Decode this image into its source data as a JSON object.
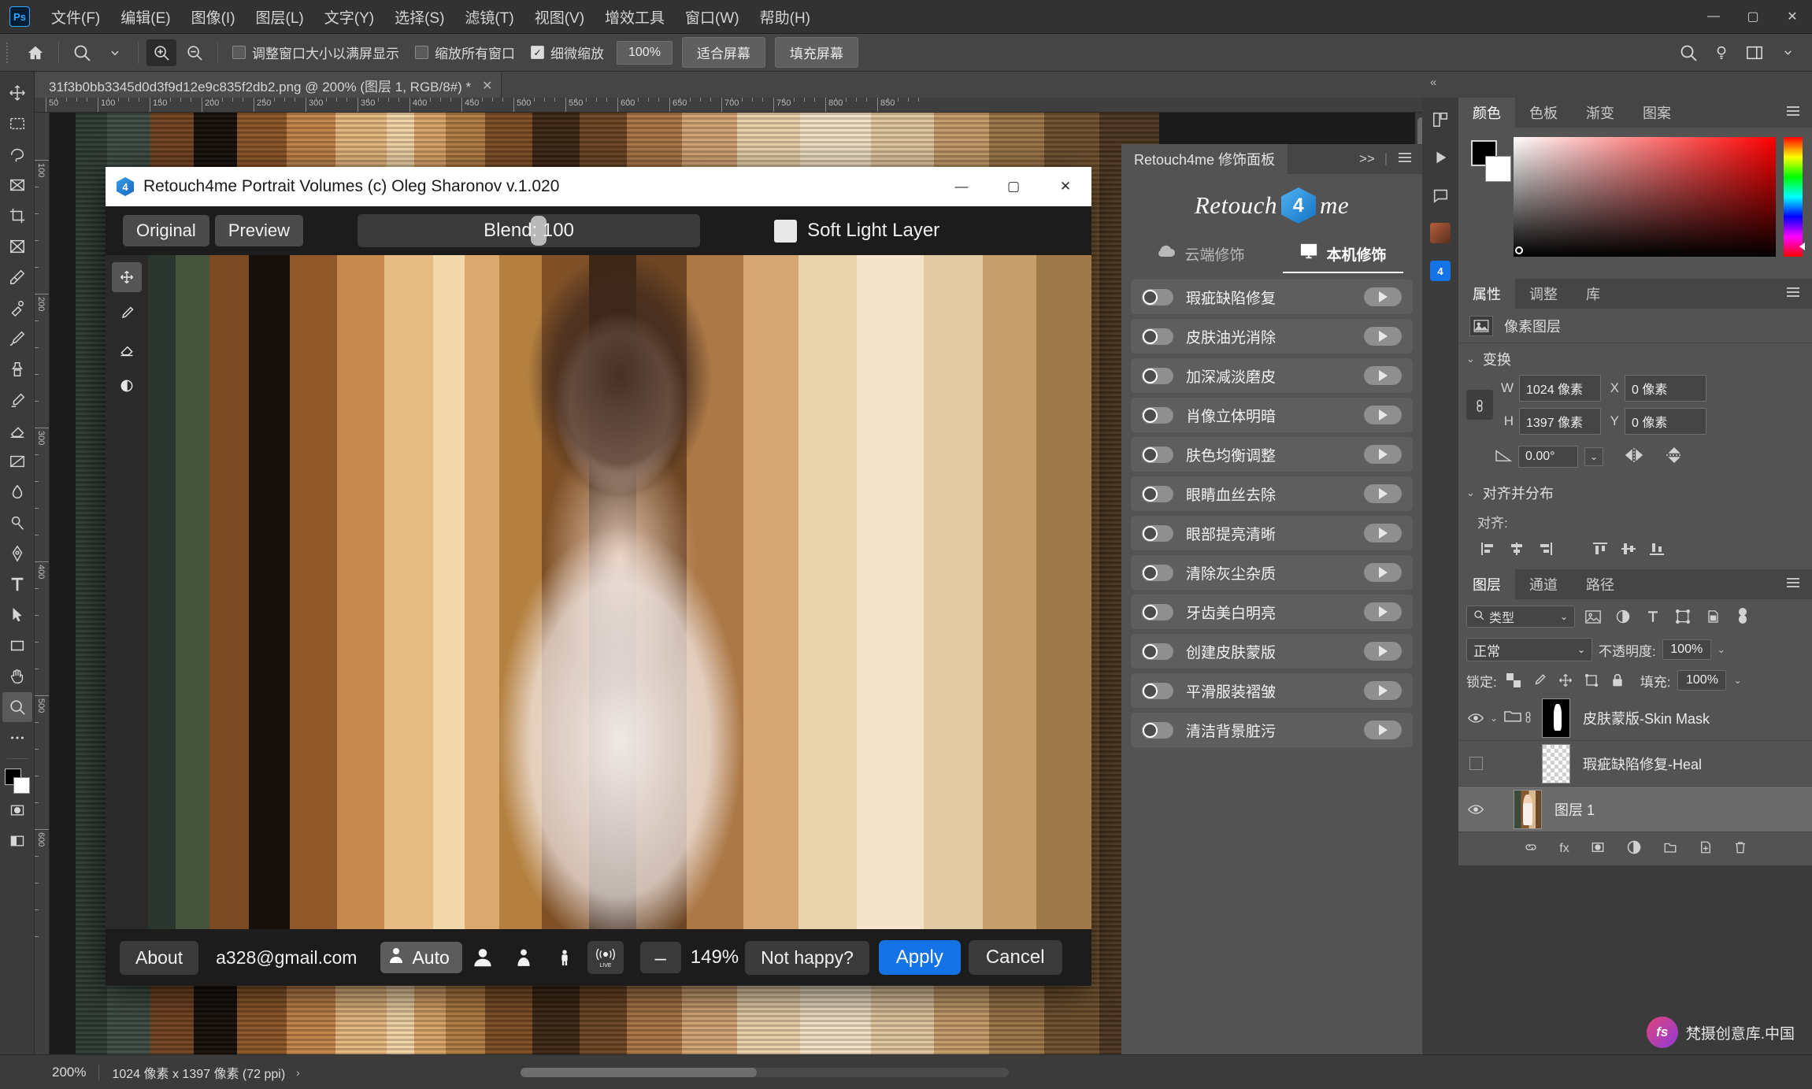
{
  "app": {
    "logo": "Ps",
    "menus": [
      "文件(F)",
      "编辑(E)",
      "图像(I)",
      "图层(L)",
      "文字(Y)",
      "选择(S)",
      "滤镜(T)",
      "视图(V)",
      "增效工具",
      "窗口(W)",
      "帮助(H)"
    ],
    "window_controls": {
      "minimize": "—",
      "maximize": "▢",
      "close": "✕"
    }
  },
  "options_bar": {
    "home_icon": "home-icon",
    "zoom_tool_icon": "zoom-tool-icon",
    "dropdown_icon": "chevron-down-icon",
    "zoom_in_icon": "zoom-in-icon",
    "zoom_out_icon": "zoom-out-icon",
    "check_resize_window": {
      "label": "调整窗口大小以满屏显示",
      "checked": false
    },
    "check_zoom_all_windows": {
      "label": "缩放所有窗口",
      "checked": false
    },
    "check_scrubby_zoom": {
      "label": "细微缩放",
      "checked": true
    },
    "zoom_value": "100%",
    "fit_screen": "适合屏幕",
    "fill_screen": "填充屏幕",
    "right_search_icon": "search-icon",
    "right_bulb_icon": "lightbulb-icon",
    "right_workspace_icon": "workspace-icon",
    "right_chevron_icon": "chevron-down-icon"
  },
  "document_tab": {
    "title": "31f3b0bb3345d0d3f9d12e9c835f2db2.png @ 200% (图层 1, RGB/8#) *",
    "close": "✕"
  },
  "toolbar": {
    "tools": [
      {
        "name": "move-tool",
        "glyph": "move"
      },
      {
        "name": "marquee-tool",
        "glyph": "marquee"
      },
      {
        "name": "lasso-tool",
        "glyph": "lasso"
      },
      {
        "name": "object-select-tool",
        "glyph": "objsel"
      },
      {
        "name": "crop-tool",
        "glyph": "crop"
      },
      {
        "name": "frame-tool",
        "glyph": "frame"
      },
      {
        "name": "eyedropper-tool",
        "glyph": "eyedrop"
      },
      {
        "name": "healing-brush-tool",
        "glyph": "heal"
      },
      {
        "name": "brush-tool",
        "glyph": "brush"
      },
      {
        "name": "clone-stamp-tool",
        "glyph": "stamp"
      },
      {
        "name": "history-brush-tool",
        "glyph": "histbrush"
      },
      {
        "name": "eraser-tool",
        "glyph": "eraser"
      },
      {
        "name": "gradient-tool",
        "glyph": "gradient"
      },
      {
        "name": "blur-tool",
        "glyph": "blur"
      },
      {
        "name": "dodge-tool",
        "glyph": "dodge"
      },
      {
        "name": "pen-tool",
        "glyph": "pen"
      },
      {
        "name": "type-tool",
        "glyph": "T"
      },
      {
        "name": "path-select-tool",
        "glyph": "pathsel"
      },
      {
        "name": "shape-tool",
        "glyph": "shape"
      },
      {
        "name": "hand-tool",
        "glyph": "hand"
      },
      {
        "name": "zoom-tool",
        "glyph": "zoom",
        "active": true
      },
      {
        "name": "more-tools",
        "glyph": "dots"
      }
    ],
    "foreground_color": "#000000",
    "background_color": "#ffffff",
    "quickmask_icon": "quick-mask-icon",
    "screenmode_icon": "screen-mode-icon"
  },
  "rulers": {
    "horizontal": [
      "50",
      "100",
      "150",
      "200",
      "250",
      "300",
      "350",
      "400",
      "450",
      "500",
      "550",
      "600",
      "650",
      "700",
      "750",
      "800",
      "850"
    ],
    "vertical": [
      "100",
      "200",
      "300",
      "400",
      "500",
      "600"
    ]
  },
  "plugin": {
    "title": "Retouch4me Portrait Volumes (c) Oleg Sharonov v.1.020",
    "icon": "retouch4me-icon",
    "window_controls": {
      "minimize": "—",
      "maximize": "▢",
      "close": "✕"
    },
    "original_button": "Original",
    "preview_button": "Preview",
    "blend_label": "Blend: 100",
    "blend_value": 100,
    "soft_light_layer": "Soft Light Layer",
    "soft_light_checked": true,
    "tools": [
      {
        "name": "pan-tool",
        "glyph": "move",
        "active": true
      },
      {
        "name": "brush-tool",
        "glyph": "brush"
      },
      {
        "name": "eraser-tool",
        "glyph": "eraser"
      },
      {
        "name": "mask-tool",
        "glyph": "mask"
      }
    ],
    "bottom": {
      "about": "About",
      "email": "a328@gmail.com",
      "auto_label": "Auto",
      "auto_icon": "person-auto-icon",
      "face_icon": "face-icon",
      "portrait_icon": "portrait-icon",
      "fullbody-icon": "full-body-icon",
      "live_icon": "live-icon",
      "zoom_out": "–",
      "zoom_value": "149%",
      "not_happy": "Not happy?",
      "apply": "Apply",
      "cancel": "Cancel",
      "apply_color": "#1473e6"
    }
  },
  "r4m_panel": {
    "tab_title": "Retouch4me 修饰面板",
    "expand_icon": ">>",
    "menu_icon": "hamburger-icon",
    "logo_text_left": "Retouch",
    "logo_hex": "4",
    "logo_text_right": "me",
    "modes": [
      {
        "label": "云端修饰",
        "icon": "cloud-icon",
        "active": false
      },
      {
        "label": "本机修饰",
        "icon": "monitor-icon",
        "active": true
      }
    ],
    "items": [
      {
        "label": "瑕疵缺陷修复",
        "enabled": false
      },
      {
        "label": "皮肤油光消除",
        "enabled": false
      },
      {
        "label": "加深减淡磨皮",
        "enabled": false
      },
      {
        "label": "肖像立体明暗",
        "enabled": false
      },
      {
        "label": "肤色均衡调整",
        "enabled": false
      },
      {
        "label": "眼睛血丝去除",
        "enabled": false
      },
      {
        "label": "眼部提亮清晰",
        "enabled": false
      },
      {
        "label": "清除灰尘杂质",
        "enabled": false
      },
      {
        "label": "牙齿美白明亮",
        "enabled": false
      },
      {
        "label": "创建皮肤蒙版",
        "enabled": false
      },
      {
        "label": "平滑服装褶皱",
        "enabled": false
      },
      {
        "label": "清洁背景脏污",
        "enabled": false
      }
    ]
  },
  "dock": {
    "collapse_icon": "«",
    "icons": [
      "panels-icon",
      "play-icon",
      "comment-icon",
      "retouch-plugin-icon",
      "blue-plugin-icon"
    ]
  },
  "color_panel": {
    "tabs": [
      "颜色",
      "色板",
      "渐变",
      "图案"
    ],
    "active_tab": "颜色",
    "menu_icon": "hamburger-icon",
    "foreground": "#000000",
    "background": "#ffffff"
  },
  "properties_panel": {
    "tabs": [
      "属性",
      "调整",
      "库"
    ],
    "active_tab": "属性",
    "menu_icon": "hamburger-icon",
    "layer_type_icon": "pixel-layer-icon",
    "layer_type": "像素图层",
    "transform_section": "变换",
    "w_key": "W",
    "w_value": "1024 像素",
    "x_key": "X",
    "x_value": "0 像素",
    "h_key": "H",
    "h_value": "1397 像素",
    "y_key": "Y",
    "y_value": "0 像素",
    "link_icon": "link-icon",
    "angle_icon": "angle-icon",
    "angle_value": "0.00°",
    "angle_dropdown": "chevron-down-icon",
    "flip_h_icon": "flip-horizontal-icon",
    "flip_v_icon": "flip-vertical-icon",
    "align_section": "对齐并分布",
    "align_label": "对齐:",
    "align_icons": [
      "align-left-icon",
      "align-center-h-icon",
      "align-right-icon",
      "align-top-icon",
      "align-middle-v-icon",
      "align-bottom-icon"
    ]
  },
  "layers_panel": {
    "tabs": [
      "图层",
      "通道",
      "路径"
    ],
    "active_tab": "图层",
    "menu_icon": "hamburger-icon",
    "filter_placeholder": "类型",
    "filter_search_icon": "search-icon",
    "filter_dropdown_icon": "chevron-down-icon",
    "filter_icons": [
      "image-filter-icon",
      "adjustment-filter-icon",
      "type-filter-icon",
      "shape-filter-icon",
      "smartobject-filter-icon",
      "toggle-filter-icon"
    ],
    "blend_mode": "正常",
    "opacity_label": "不透明度:",
    "opacity_value": "100%",
    "lock_label": "锁定:",
    "lock_icons": [
      "lock-transparent-icon",
      "lock-image-icon",
      "lock-position-icon",
      "lock-artboard-icon",
      "lock-all-icon"
    ],
    "fill_label": "填充:",
    "fill_value": "100%",
    "layers": [
      {
        "name": "皮肤蒙版-Skin Mask",
        "visible": true,
        "type": "group-mask",
        "selected": false
      },
      {
        "name": "瑕疵缺陷修复-Heal",
        "visible": false,
        "type": "transparent",
        "selected": false
      },
      {
        "name": "图层 1",
        "visible": true,
        "type": "photo",
        "selected": true
      }
    ],
    "bottom_icons": [
      "link-layers-icon",
      "layer-style-icon",
      "add-mask-icon",
      "adjustment-layer-icon",
      "new-group-icon",
      "new-layer-icon",
      "delete-layer-icon"
    ]
  },
  "status_bar": {
    "zoom": "200%",
    "doc_info": "1024 像素 x 1397 像素 (72 ppi)",
    "arrow_icon": "chevron-right-icon"
  },
  "watermark": {
    "badge": "fs",
    "text": "梵摄创意库.中国"
  }
}
